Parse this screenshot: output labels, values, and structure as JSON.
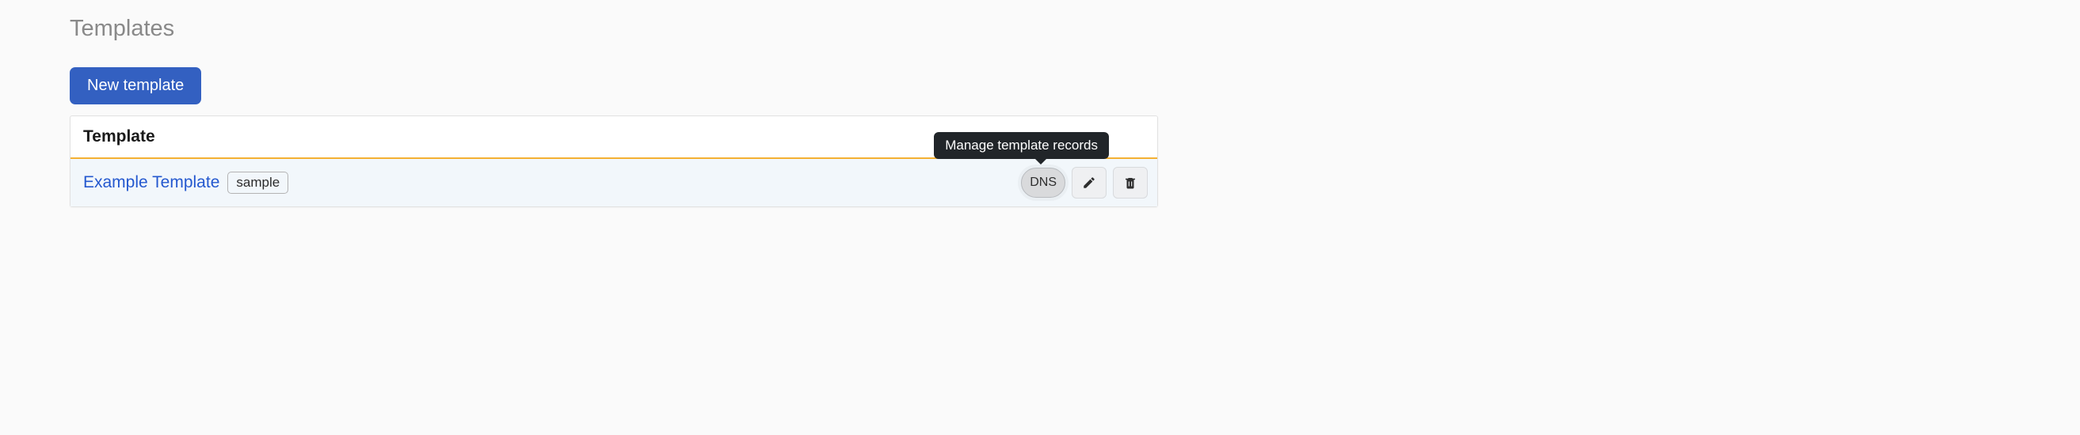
{
  "page": {
    "title": "Templates"
  },
  "toolbar": {
    "new_template_label": "New template"
  },
  "table": {
    "header_label": "Template",
    "rows": [
      {
        "name": "Example Template",
        "tag": "sample",
        "dns_label": "DNS",
        "tooltip": "Manage template records"
      }
    ]
  }
}
